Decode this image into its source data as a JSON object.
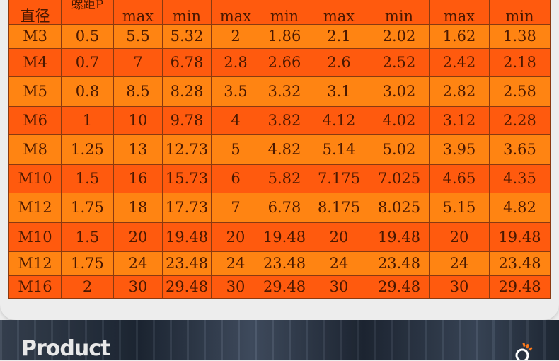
{
  "table": {
    "header": [
      "直径",
      "螺距P",
      "max",
      "min",
      "max",
      "min",
      "max",
      "min",
      "max",
      "min"
    ],
    "rows": [
      [
        "M3",
        "0.5",
        "5.5",
        "5.32",
        "2",
        "1.86",
        "2.1",
        "2.02",
        "1.62",
        "1.38"
      ],
      [
        "M4",
        "0.7",
        "7",
        "6.78",
        "2.8",
        "2.66",
        "2.6",
        "2.52",
        "2.42",
        "2.18"
      ],
      [
        "M5",
        "0.8",
        "8.5",
        "8.28",
        "3.5",
        "3.32",
        "3.1",
        "3.02",
        "2.82",
        "2.58"
      ],
      [
        "M6",
        "1",
        "10",
        "9.78",
        "4",
        "3.82",
        "4.12",
        "4.02",
        "3.12",
        "2.28"
      ],
      [
        "M8",
        "1.25",
        "13",
        "12.73",
        "5",
        "4.82",
        "5.14",
        "5.02",
        "3.95",
        "3.65"
      ],
      [
        "M10",
        "1.5",
        "16",
        "15.73",
        "6",
        "5.82",
        "7.175",
        "7.025",
        "4.65",
        "4.35"
      ],
      [
        "M12",
        "1.75",
        "18",
        "17.73",
        "7",
        "6.78",
        "8.175",
        "8.025",
        "5.15",
        "4.82"
      ],
      [
        "M10",
        "1.5",
        "20",
        "19.48",
        "20",
        "19.48",
        "20",
        "19.48",
        "20",
        "19.48"
      ],
      [
        "M12",
        "1.75",
        "24",
        "23.48",
        "24",
        "23.48",
        "24",
        "23.48",
        "24",
        "23.48"
      ],
      [
        "M16",
        "2",
        "30",
        "29.48",
        "30",
        "29.48",
        "30",
        "29.48",
        "30",
        "29.48"
      ]
    ]
  },
  "colors": {
    "row_orange": "#ff8412",
    "row_orange_red": "#ff5a0e",
    "cell_text": "#4a1800",
    "band_dark": "#1e2836"
  },
  "footer": {
    "title": "Product",
    "icon": "search-icon"
  }
}
